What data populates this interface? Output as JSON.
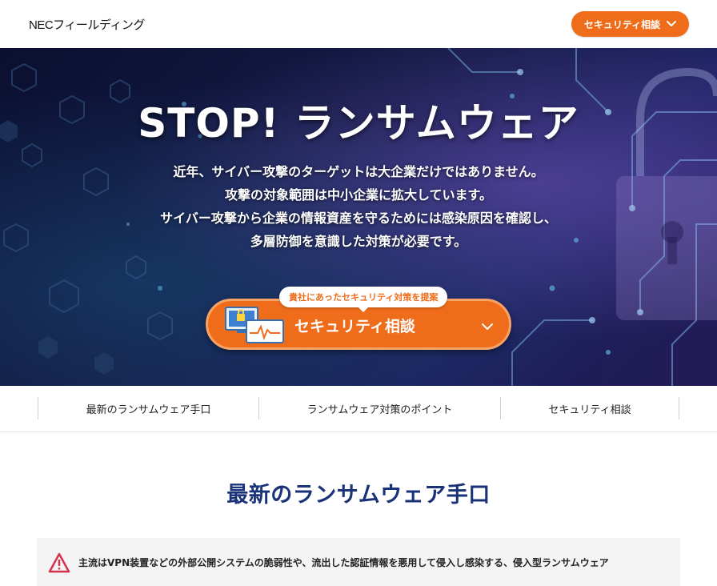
{
  "header": {
    "logo_text": "NECフィールディング",
    "cta_label": "セキュリティ相談"
  },
  "hero": {
    "title": "STOP! ランサムウェア",
    "lines": [
      "近年、サイバー攻撃のターゲットは大企業だけではありません。",
      "攻撃の対象範囲は中小企業に拡大しています。",
      "サイバー攻撃から企業の情報資産を守るためには感染原因を確認し、",
      "多層防御を意識した対策が必要です。"
    ],
    "cta_badge": "貴社にあったセキュリティ対策を提案",
    "cta_label": "セキュリティ相談"
  },
  "subnav": {
    "items": [
      {
        "label": "最新のランサムウェア手口"
      },
      {
        "label": "ランサムウェア対策のポイント"
      },
      {
        "label": "セキュリティ相談"
      }
    ]
  },
  "section": {
    "title": "最新のランサムウェア手口",
    "notice_text": "主流はVPN装置などの外部公開システムの脆弱性や、流出した認証情報を悪用して侵入し感染する、侵入型ランサムウェア"
  },
  "colors": {
    "accent": "#ef6c1a",
    "heading": "#1a3278",
    "hero_bg": "#141a45"
  },
  "icons": {
    "header_cta": "chevron-down-icon",
    "cta_illustration": "computer-security-icon",
    "notice": "warning-icon"
  }
}
